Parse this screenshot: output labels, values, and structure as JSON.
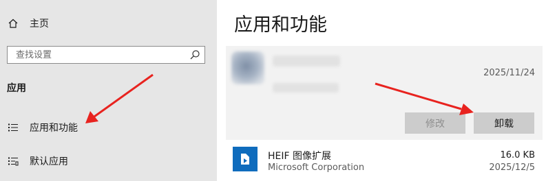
{
  "sidebar": {
    "home_label": "主页",
    "search_placeholder": "查找设置",
    "section_title": "应用",
    "items": [
      {
        "label": "应用和功能",
        "icon": "apps-features-icon"
      },
      {
        "label": "默认应用",
        "icon": "default-apps-icon"
      }
    ]
  },
  "main": {
    "title": "应用和功能",
    "selected_app": {
      "date": "2025/11/24",
      "modify_label": "修改",
      "uninstall_label": "卸载"
    },
    "apps": [
      {
        "name": "HEIF 图像扩展",
        "publisher": "Microsoft Corporation",
        "size": "16.0 KB",
        "date": "2025/12/5",
        "icon": "heif-extension-icon"
      }
    ]
  },
  "annotations": {
    "arrow_color": "#e8231f"
  },
  "colors": {
    "sidebar_bg": "#e6e6e6",
    "card_bg": "#f2f2f2",
    "button_bg": "#cccccc",
    "accent": "#0f6cbd"
  }
}
